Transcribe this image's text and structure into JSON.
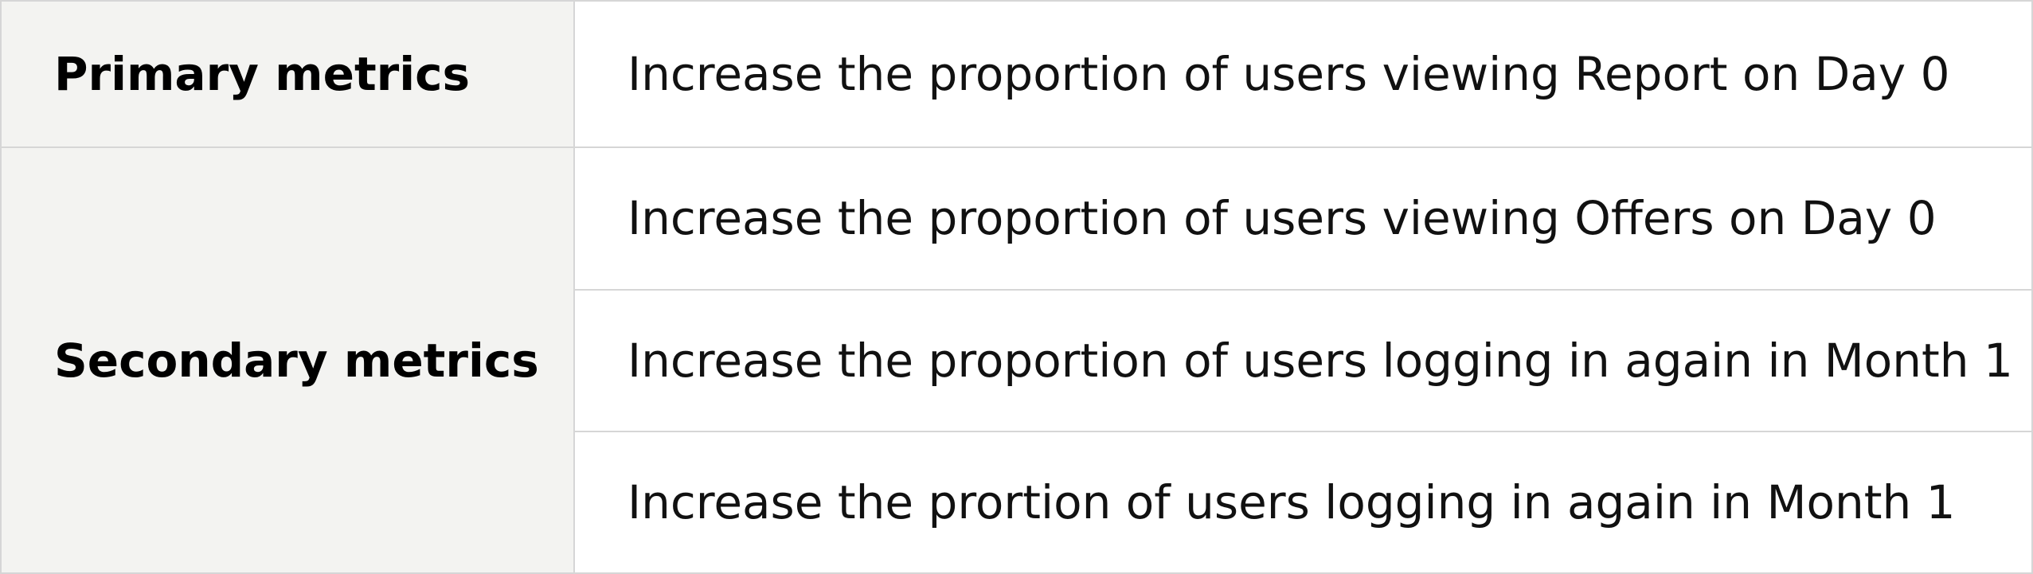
{
  "table": {
    "primary": {
      "label": "Primary metrics",
      "items": [
        "Increase the proportion of users viewing Report on Day 0"
      ]
    },
    "secondary": {
      "label": "Secondary metrics",
      "items": [
        "Increase the proportion of users viewing Offers on Day 0",
        "Increase the proportion of users logging in again in Month 1",
        "Increase the prortion of users logging in again in Month 1"
      ]
    }
  }
}
